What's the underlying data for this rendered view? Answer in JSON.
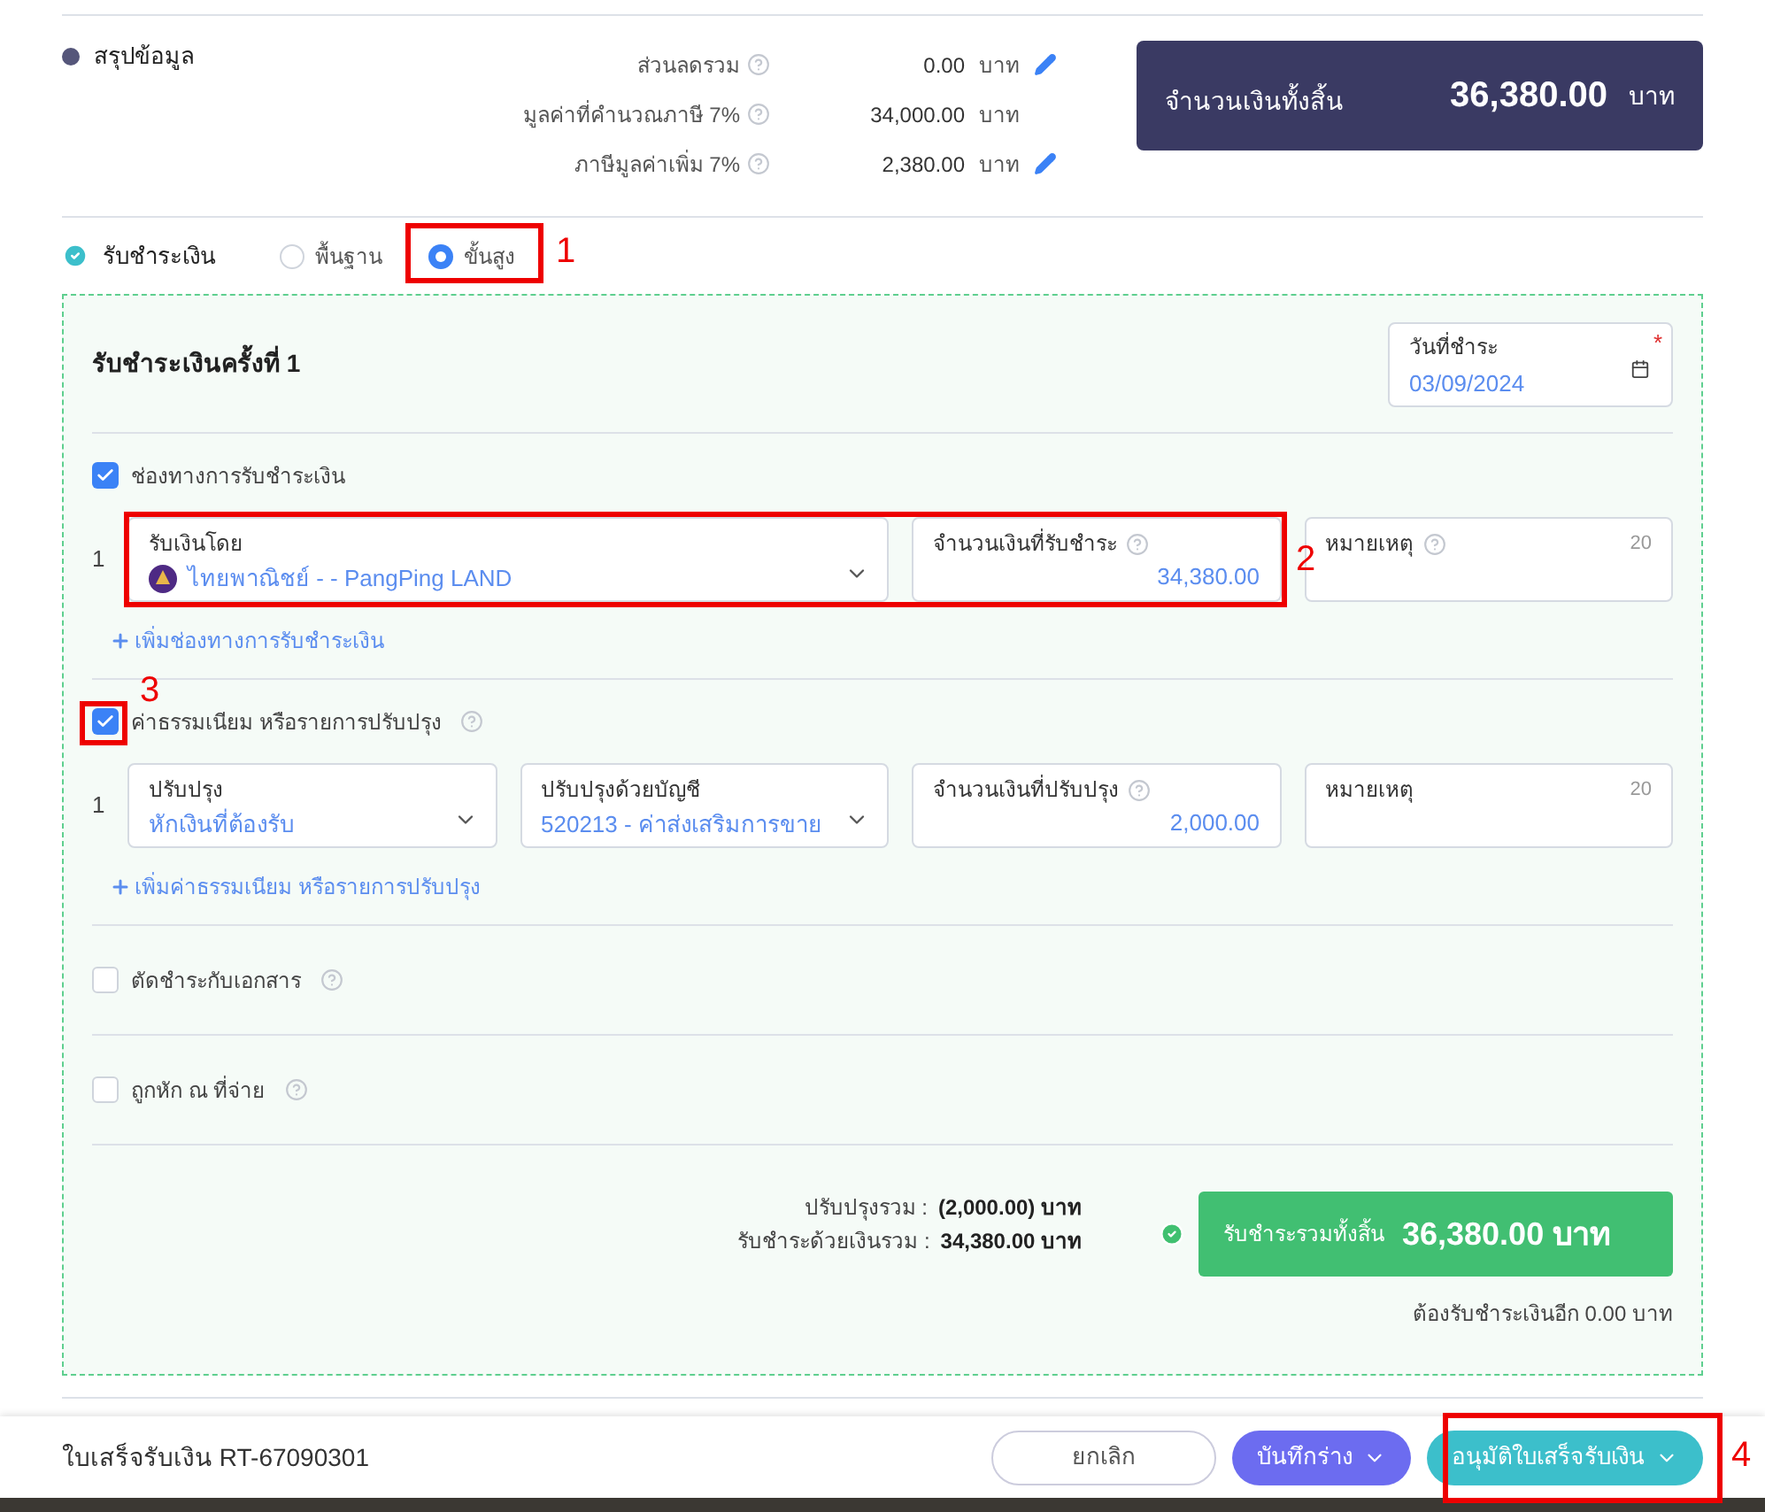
{
  "summary": {
    "title": "สรุปข้อมูล",
    "rows": [
      {
        "label": "ส่วนลดรวม",
        "value": "0.00",
        "unit": "บาท",
        "editable": true
      },
      {
        "label": "มูลค่าที่คำนวณภาษี 7%",
        "value": "34,000.00",
        "unit": "บาท",
        "editable": false
      },
      {
        "label": "ภาษีมูลค่าเพิ่ม 7%",
        "value": "2,380.00",
        "unit": "บาท",
        "editable": true
      }
    ],
    "total": {
      "label": "จำนวนเงินทั้งสิ้น",
      "value": "36,380.00",
      "unit": "บาท"
    }
  },
  "payment": {
    "title": "รับชำระเงิน",
    "modes": [
      {
        "label": "พื้นฐาน",
        "selected": false
      },
      {
        "label": "ขั้นสูง",
        "selected": true
      }
    ],
    "installment": {
      "title": "รับชำระเงินครั้งที่ 1",
      "date": {
        "label": "วันที่ชำระ",
        "required_mark": "*",
        "value": "03/09/2024"
      }
    },
    "sections": [
      {
        "label": "ช่องทางการรับชำระเงิน",
        "checked": true,
        "help": false,
        "rows": [
          {
            "number": "1",
            "fields": [
              {
                "kind": "select",
                "label": "รับเงินโดย",
                "value": "ไทยพาณิชย์ - - PangPing LAND",
                "bank": true
              },
              {
                "kind": "amount",
                "label": "จำนวนเงินที่รับชำระ",
                "value": "34,380.00",
                "help": true
              },
              {
                "kind": "note",
                "label": "หมายเหตุ",
                "counter": "20",
                "help": true
              }
            ]
          }
        ],
        "add_link": "เพิ่มช่องทางการรับชำระเงิน"
      },
      {
        "label": "ค่าธรรมเนียม หรือรายการปรับปรุง",
        "checked": true,
        "help": true,
        "rows": [
          {
            "number": "1",
            "fields": [
              {
                "kind": "select",
                "label": "ปรับปรุง",
                "value": "หักเงินที่ต้องรับ",
                "bank": false
              },
              {
                "kind": "select",
                "label": "ปรับปรุงด้วยบัญชี",
                "value": "520213 - ค่าส่งเสริมการขาย",
                "bank": false
              },
              {
                "kind": "amount",
                "label": "จำนวนเงินที่ปรับปรุง",
                "value": "2,000.00",
                "help": true
              },
              {
                "kind": "note",
                "label": "หมายเหตุ",
                "counter": "20",
                "help": false
              }
            ]
          }
        ],
        "add_link": "เพิ่มค่าธรรมเนียม หรือรายการปรับปรุง"
      },
      {
        "label": "ตัดชำระกับเอกสาร",
        "checked": false,
        "help": true
      },
      {
        "label": "ถูกหัก ณ ที่จ่าย",
        "checked": false,
        "help": true
      }
    ],
    "totals": {
      "lines": [
        {
          "label": "ปรับปรุงรวม :",
          "value": "(2,000.00) บาท"
        },
        {
          "label": "รับชำระด้วยเงินรวม :",
          "value": "34,380.00 บาท"
        }
      ],
      "grand": {
        "label": "รับชำระรวมทั้งสิ้น",
        "value": "36,380.00 บาท",
        "complete": true
      },
      "remaining": "ต้องรับชำระเงินอีก 0.00 บาท"
    }
  },
  "footer": {
    "document": "ใบเสร็จรับเงิน RT-67090301",
    "buttons": [
      {
        "label": "ยกเลิก",
        "kind": "cancel"
      },
      {
        "label": "บันทึกร่าง",
        "kind": "draft"
      },
      {
        "label": "อนุมัติใบเสร็จรับเงิน",
        "kind": "approve"
      }
    ]
  },
  "annotations": [
    {
      "label": "1"
    },
    {
      "label": "2"
    },
    {
      "label": "3"
    },
    {
      "label": "4"
    }
  ]
}
